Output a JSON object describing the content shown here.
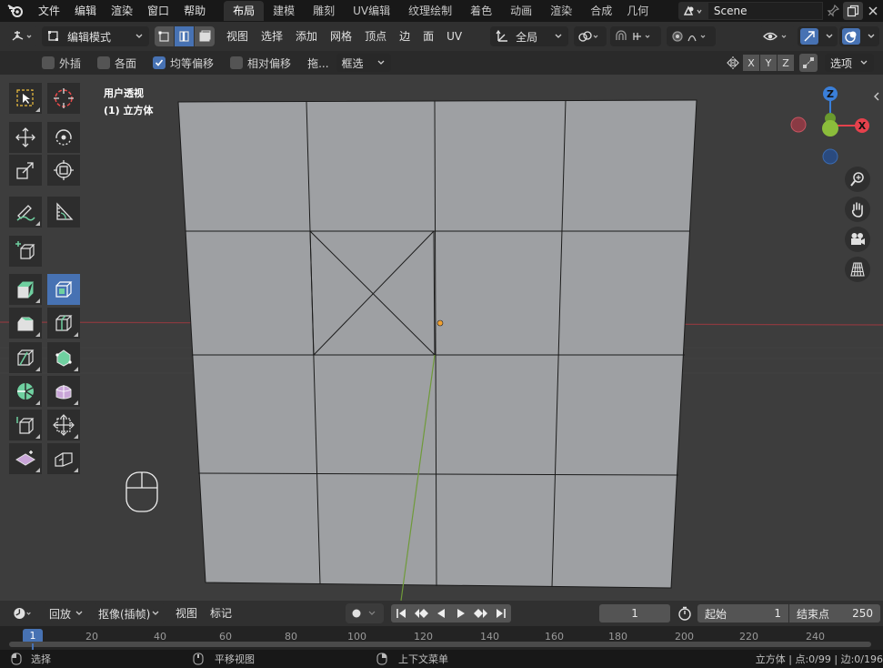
{
  "topbar": {
    "menus": [
      "文件",
      "编辑",
      "渲染",
      "窗口",
      "帮助"
    ],
    "workspaces": [
      "布局",
      "建模",
      "雕刻",
      "UV编辑",
      "纹理绘制",
      "着色",
      "动画",
      "渲染",
      "合成",
      "几何"
    ],
    "active_workspace": "布局",
    "scene_name": "Scene"
  },
  "header": {
    "mode": "编辑模式",
    "menus": [
      "视图",
      "选择",
      "添加",
      "网格",
      "顶点",
      "边",
      "面",
      "UV"
    ],
    "transform_orientation": "全局"
  },
  "tool_settings": {
    "options": [
      {
        "label": "外插",
        "checked": false
      },
      {
        "label": "各面",
        "checked": false
      },
      {
        "label": "均等偏移",
        "checked": true
      },
      {
        "label": "相对偏移",
        "checked": false
      }
    ],
    "drag_label": "拖...",
    "drag_value": "框选",
    "axes": [
      "X",
      "Y",
      "Z"
    ],
    "options_label": "选项"
  },
  "viewport": {
    "view_name": "用户透视",
    "object_name": "(1) 立方体",
    "gizmo": {
      "z": "Z",
      "x": "X"
    }
  },
  "timeline": {
    "playback": "回放",
    "keying": "抠像(插帧)",
    "view": "视图",
    "markers": "标记",
    "current_frame": "1",
    "start_label": "起始",
    "start_value": "1",
    "end_label": "结束点",
    "end_value": "250",
    "ruler_current": "1",
    "ruler_ticks": [
      "20",
      "40",
      "60",
      "80",
      "100",
      "120",
      "140",
      "160",
      "180",
      "200",
      "220",
      "240"
    ]
  },
  "status": {
    "select": "选择",
    "pan": "平移视图",
    "context": "上下文菜单",
    "stats": "立方体 | 点:0/99 | 边:0/196"
  },
  "colors": {
    "accent": "#4772b3",
    "axis_x": "#e5414c",
    "axis_y": "#8bbd3b",
    "axis_z": "#3a7fd9"
  }
}
